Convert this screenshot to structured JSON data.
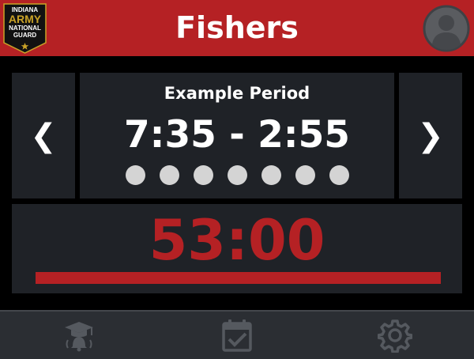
{
  "header": {
    "title": "Fishers",
    "logo_lines": [
      "INDIANA",
      "ARMY",
      "NATIONAL",
      "GUARD"
    ],
    "logo_icon": "star-icon",
    "profile_icon": "user-avatar-icon"
  },
  "schedule": {
    "prev_label": "❮",
    "next_label": "❯",
    "period_name": "Example Period",
    "period_time": "7:35 - 2:55",
    "period_dot_count": 7
  },
  "timer": {
    "countdown": "53:00",
    "progress_fraction": 1.0
  },
  "nav": {
    "items": [
      {
        "icon": "graduation-bell-icon"
      },
      {
        "icon": "calendar-check-icon"
      },
      {
        "icon": "gear-icon"
      }
    ]
  },
  "colors": {
    "accent": "#b52124",
    "panel": "#1f2227",
    "background": "#000000",
    "footer": "#2b2e33",
    "nav_icon": "#55595f",
    "dot": "#d4d4d4"
  }
}
